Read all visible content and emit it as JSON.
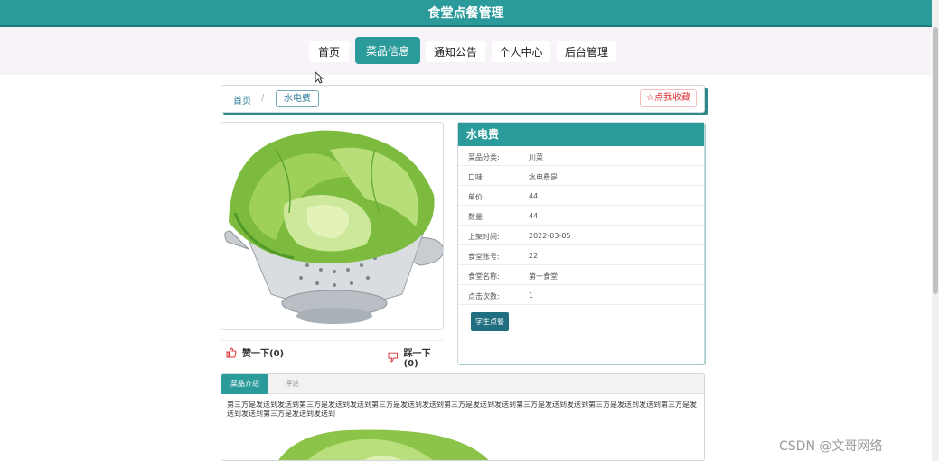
{
  "header": {
    "title": "食堂点餐管理"
  },
  "nav": {
    "items": [
      {
        "label": "首页"
      },
      {
        "label": "菜品信息"
      },
      {
        "label": "通知公告"
      },
      {
        "label": "个人中心"
      },
      {
        "label": "后台管理"
      }
    ],
    "active_index": 1
  },
  "breadcrumb": {
    "home": "首页",
    "separator": "/",
    "current": "水电费"
  },
  "favorite": {
    "icon": "star-outline-icon",
    "label": "点我收藏"
  },
  "votes": {
    "up_label": "赞一下(0)",
    "down_label": "踩一下(0)"
  },
  "info": {
    "title": "水电费",
    "rows": [
      {
        "key": "菜品分类:",
        "value": "川菜"
      },
      {
        "key": "口味:",
        "value": "水电费是"
      },
      {
        "key": "单价:",
        "value": "44"
      },
      {
        "key": "数量:",
        "value": "44"
      },
      {
        "key": "上架时间:",
        "value": "2022-03-05"
      },
      {
        "key": "食堂账号:",
        "value": "22"
      },
      {
        "key": "食堂名称:",
        "value": "第一食堂"
      },
      {
        "key": "点击次数:",
        "value": "1"
      }
    ],
    "order_button": "学生点餐"
  },
  "tabs": {
    "items": [
      {
        "label": "菜品介绍"
      },
      {
        "label": "评论"
      }
    ],
    "description": "第三方是发送到发送到第三方是发送到发送到第三方是发送到发送到第三方是发送到发送到第三方是发送到发送到第三方是发送到发送到第三方是发送到发送到第三方是发送到发送到"
  },
  "watermark": "CSDN @文哥网络",
  "colors": {
    "accent": "#2a9a9b",
    "heart": "#d33333"
  }
}
